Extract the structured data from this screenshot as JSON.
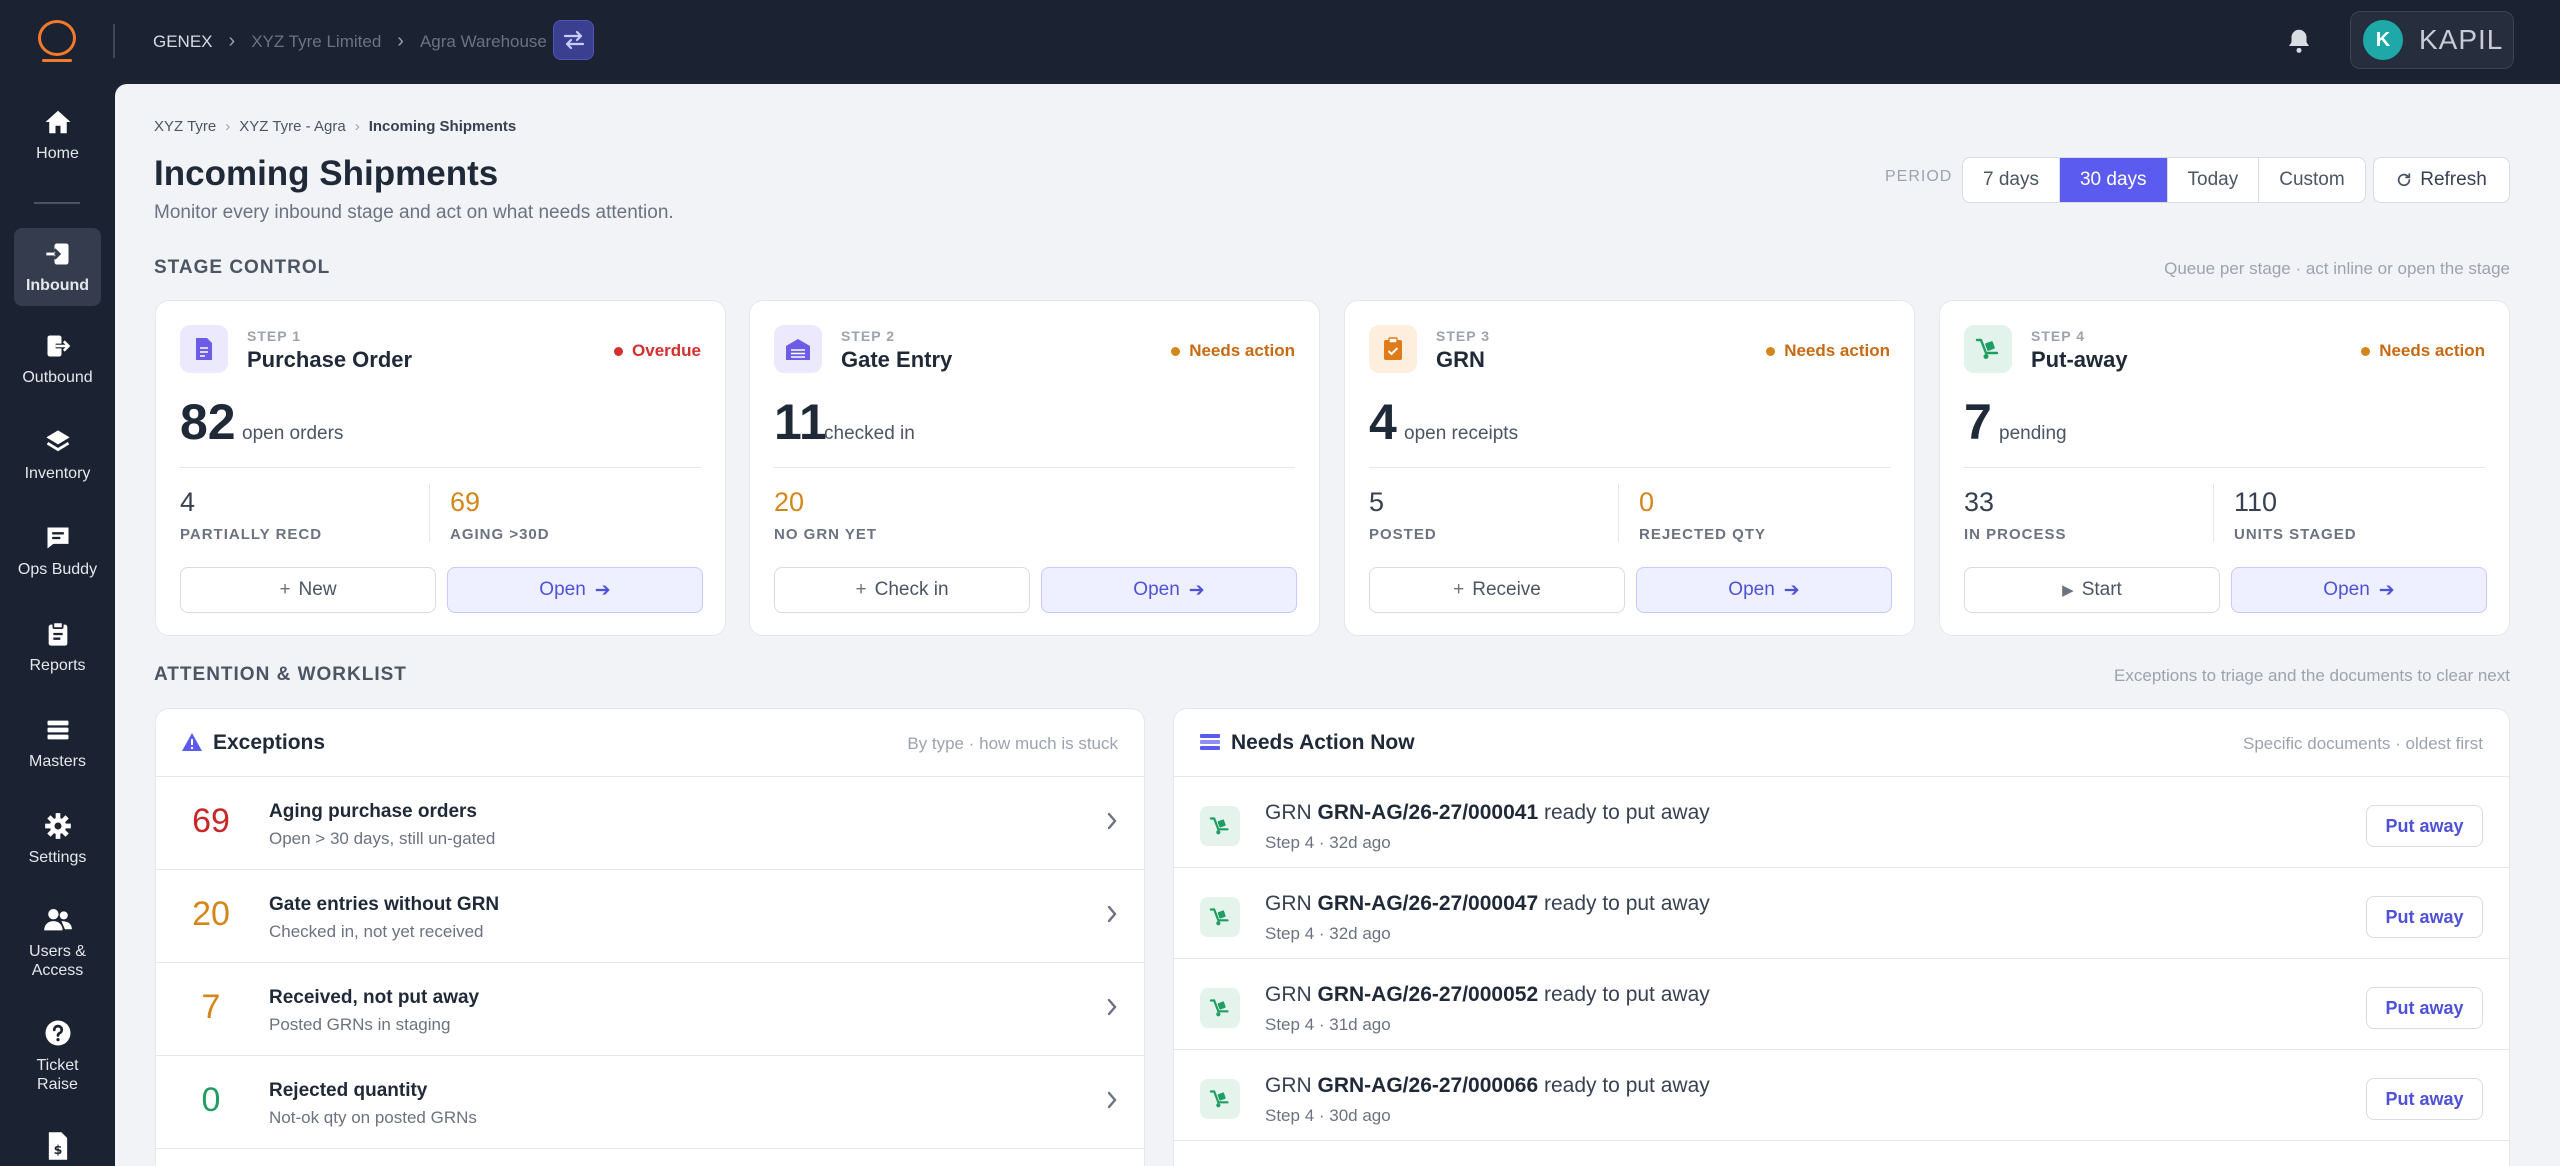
{
  "topbar": {
    "breadcrumb": [
      "GENEX",
      "XYZ Tyre Limited",
      "Agra Warehouse"
    ],
    "user": {
      "initial": "K",
      "name": "KAPIL"
    }
  },
  "sidebar": {
    "items": [
      {
        "label": "Home",
        "icon": "home-icon"
      },
      {
        "label": "Inbound",
        "icon": "inbound-icon",
        "active": true
      },
      {
        "label": "Outbound",
        "icon": "outbound-icon"
      },
      {
        "label": "Inventory",
        "icon": "layers-icon"
      },
      {
        "label": "Ops Buddy",
        "icon": "chat-icon"
      },
      {
        "label": "Reports",
        "icon": "clipboard-icon"
      },
      {
        "label": "Masters",
        "icon": "list-icon"
      },
      {
        "label": "Settings",
        "icon": "gear-icon"
      },
      {
        "label": "Users &\nAccess",
        "icon": "users-icon"
      },
      {
        "label": "Ticket\nRaise",
        "icon": "help-icon"
      }
    ]
  },
  "breadcrumb": [
    "XYZ Tyre",
    "XYZ Tyre - Agra",
    "Incoming Shipments"
  ],
  "page": {
    "title": "Incoming Shipments",
    "subtitle": "Monitor every inbound stage and act on what needs attention."
  },
  "period": {
    "label": "PERIOD",
    "options": [
      "7 days",
      "30 days",
      "Today",
      "Custom"
    ],
    "selected": "30 days"
  },
  "refresh_label": "Refresh",
  "stage_control": {
    "title": "STAGE CONTROL",
    "hint": "Queue per stage · act inline or open the stage",
    "cards": [
      {
        "step": "STEP 1",
        "name": "Purchase Order",
        "status": "Overdue",
        "status_color": "#d32f2f",
        "icon_bg": "#ece9fd",
        "icon_color": "#6d5ce6",
        "count": "82",
        "count_label": "open orders",
        "m1_value": "4",
        "m1_label": "PARTIALLY RECD",
        "m1_color": "#374151",
        "m2_value": "69",
        "m2_label": "AGING >30D",
        "m2_color": "#d4861b",
        "secondary_glyph": "+",
        "secondary": "New",
        "primary": "Open"
      },
      {
        "step": "STEP 2",
        "name": "Gate Entry",
        "status": "Needs action",
        "status_color": "#c76a12",
        "icon_bg": "#ece9fd",
        "icon_color": "#6d5ce6",
        "count": "11",
        "count_label": "checked in",
        "m1_value": "20",
        "m1_label": "NO GRN YET",
        "m1_color": "#d4861b",
        "secondary_glyph": "+",
        "secondary": "Check in",
        "primary": "Open"
      },
      {
        "step": "STEP 3",
        "name": "GRN",
        "status": "Needs action",
        "status_color": "#c76a12",
        "icon_bg": "#fdeedd",
        "icon_color": "#e07b1a",
        "count": "4",
        "count_label": "open receipts",
        "m1_value": "5",
        "m1_label": "POSTED",
        "m1_color": "#374151",
        "m2_value": "0",
        "m2_label": "REJECTED QTY",
        "m2_color": "#d4861b",
        "secondary_glyph": "+",
        "secondary": "Receive",
        "primary": "Open"
      },
      {
        "step": "STEP 4",
        "name": "Put-away",
        "status": "Needs action",
        "status_color": "#c76a12",
        "icon_bg": "#e1f3ea",
        "icon_color": "#1f9d63",
        "count": "7",
        "count_label": "pending",
        "m1_value": "33",
        "m1_label": "IN PROCESS",
        "m1_color": "#374151",
        "m2_value": "110",
        "m2_label": "UNITS STAGED",
        "m2_color": "#374151",
        "secondary_glyph": "▶",
        "secondary": "Start",
        "primary": "Open"
      }
    ]
  },
  "attention": {
    "title": "ATTENTION & WORKLIST",
    "hint": "Exceptions to triage and the documents to clear next"
  },
  "exceptions": {
    "title": "Exceptions",
    "hint": "By type · how much is stuck",
    "rows": [
      {
        "count": "69",
        "color": "#c62828",
        "title": "Aging purchase orders",
        "sub": "Open > 30 days, still un-gated"
      },
      {
        "count": "20",
        "color": "#d4861b",
        "title": "Gate entries without GRN",
        "sub": "Checked in, not yet received"
      },
      {
        "count": "7",
        "color": "#d4861b",
        "title": "Received, not put away",
        "sub": "Posted GRNs in staging"
      },
      {
        "count": "0",
        "color": "#1f9d63",
        "title": "Rejected quantity",
        "sub": "Not-ok qty on posted GRNs"
      }
    ]
  },
  "needs_action": {
    "title": "Needs Action Now",
    "hint": "Specific documents · oldest first",
    "rows": [
      {
        "prefix": "GRN",
        "doc": "GRN-AG/26-27/000041",
        "suffix": "ready to put away",
        "sub": "Step 4 · 32d ago",
        "action": "Put away"
      },
      {
        "prefix": "GRN",
        "doc": "GRN-AG/26-27/000047",
        "suffix": "ready to put away",
        "sub": "Step 4 · 32d ago",
        "action": "Put away"
      },
      {
        "prefix": "GRN",
        "doc": "GRN-AG/26-27/000052",
        "suffix": "ready to put away",
        "sub": "Step 4 · 31d ago",
        "action": "Put away"
      },
      {
        "prefix": "GRN",
        "doc": "GRN-AG/26-27/000066",
        "suffix": "ready to put away",
        "sub": "Step 4 · 30d ago",
        "action": "Put away"
      }
    ]
  }
}
